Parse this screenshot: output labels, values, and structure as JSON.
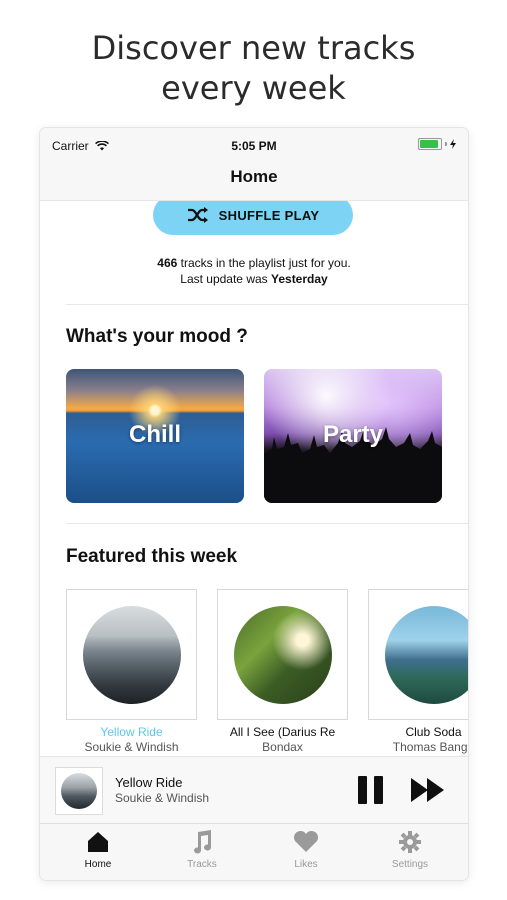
{
  "headline": {
    "line1": "Discover new tracks",
    "line2": "every week"
  },
  "status_bar": {
    "carrier": "Carrier",
    "time": "5:05 PM",
    "battery_level": 0.9
  },
  "nav": {
    "title": "Home"
  },
  "shuffle": {
    "label": "SHUFFLE PLAY"
  },
  "info": {
    "count": "466",
    "line1_rest": " tracks in the playlist just for you.",
    "line2_prefix": "Last update was ",
    "line2_value": "Yesterday"
  },
  "mood": {
    "title": "What's your mood ?",
    "cards": [
      {
        "label": "Chill"
      },
      {
        "label": "Party"
      }
    ]
  },
  "featured": {
    "title": "Featured this week",
    "tracks": [
      {
        "title": "Yellow Ride",
        "artist": "Soukie & Windish"
      },
      {
        "title": "All I See (Darius Re",
        "artist": "Bondax"
      },
      {
        "title": "Club Soda",
        "artist": "Thomas Banga"
      }
    ]
  },
  "player": {
    "title": "Yellow Ride",
    "artist": "Soukie & Windish"
  },
  "tabs": [
    {
      "label": "Home",
      "icon": "home-icon"
    },
    {
      "label": "Tracks",
      "icon": "music-note-icon"
    },
    {
      "label": "Likes",
      "icon": "heart-icon"
    },
    {
      "label": "Settings",
      "icon": "gear-icon"
    }
  ],
  "colors": {
    "accent": "#7dd3f3",
    "active_title": "#5bc7ee",
    "battery": "#35c04a"
  }
}
